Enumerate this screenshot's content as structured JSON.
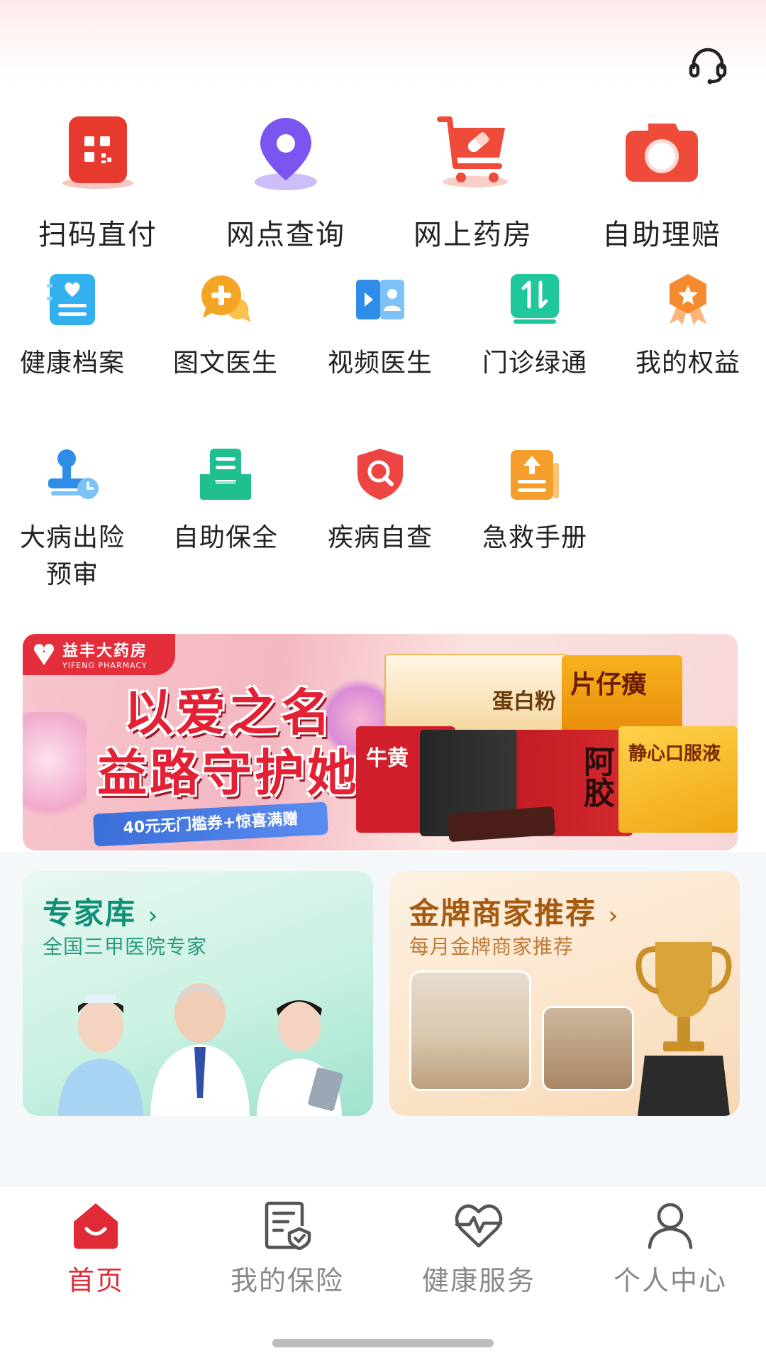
{
  "top_actions": {
    "support_icon": "headset-icon"
  },
  "big_services": [
    {
      "label": "扫码直付",
      "icon": "qr-scan-icon",
      "color": "#e8392f"
    },
    {
      "label": "网点查询",
      "icon": "location-pin-icon",
      "color": "#7b55f0"
    },
    {
      "label": "网上药房",
      "icon": "shopping-cart-icon",
      "color": "#ee4b3a"
    },
    {
      "label": "自助理赔",
      "icon": "camera-icon",
      "color": "#ee4b3a"
    }
  ],
  "small_services": [
    {
      "label": "健康档案",
      "icon": "health-record-icon",
      "color": "#33b1ef"
    },
    {
      "label": "图文医生",
      "icon": "chat-doctor-icon",
      "color": "#f5a524"
    },
    {
      "label": "视频医生",
      "icon": "video-doctor-icon",
      "color": "#2f8de8"
    },
    {
      "label": "门诊绿通",
      "icon": "green-channel-icon",
      "color": "#1fc79a"
    },
    {
      "label": "我的权益",
      "icon": "badge-icon",
      "color": "#f58a2f"
    },
    {
      "label": "大病出险\n预审",
      "icon": "stamp-clock-icon",
      "color": "#2f8de8"
    },
    {
      "label": "自助保全",
      "icon": "tray-doc-icon",
      "color": "#1fbf8f"
    },
    {
      "label": "疾病自查",
      "icon": "shield-search-icon",
      "color": "#ef4444"
    },
    {
      "label": "急救手册",
      "icon": "first-aid-manual-icon",
      "color": "#f59e2b"
    }
  ],
  "banner": {
    "brand_cn": "益丰大药房",
    "brand_en": "YIFENG PHARMACY",
    "headline_1": "以爱之名",
    "headline_2": "益路守护她",
    "ribbon": "40元无门槛券+惊喜满赠",
    "product_1": "蛋白粉",
    "product_2": "片仔癀",
    "product_3": "阿胶",
    "product_4": "静心口服液",
    "product_5": "牛黄"
  },
  "cards": {
    "expert": {
      "title": "专家库",
      "subtitle": "全国三甲医院专家"
    },
    "merchant": {
      "title": "金牌商家推荐",
      "subtitle": "每月金牌商家推荐"
    }
  },
  "bottom_nav": [
    {
      "label": "首页",
      "icon": "home-icon",
      "active": true
    },
    {
      "label": "我的保险",
      "icon": "insurance-doc-icon",
      "active": false
    },
    {
      "label": "健康服务",
      "icon": "heart-pulse-icon",
      "active": false
    },
    {
      "label": "个人中心",
      "icon": "person-icon",
      "active": false
    }
  ],
  "colors": {
    "accent": "#e02b36",
    "nav_inactive": "#888888"
  }
}
